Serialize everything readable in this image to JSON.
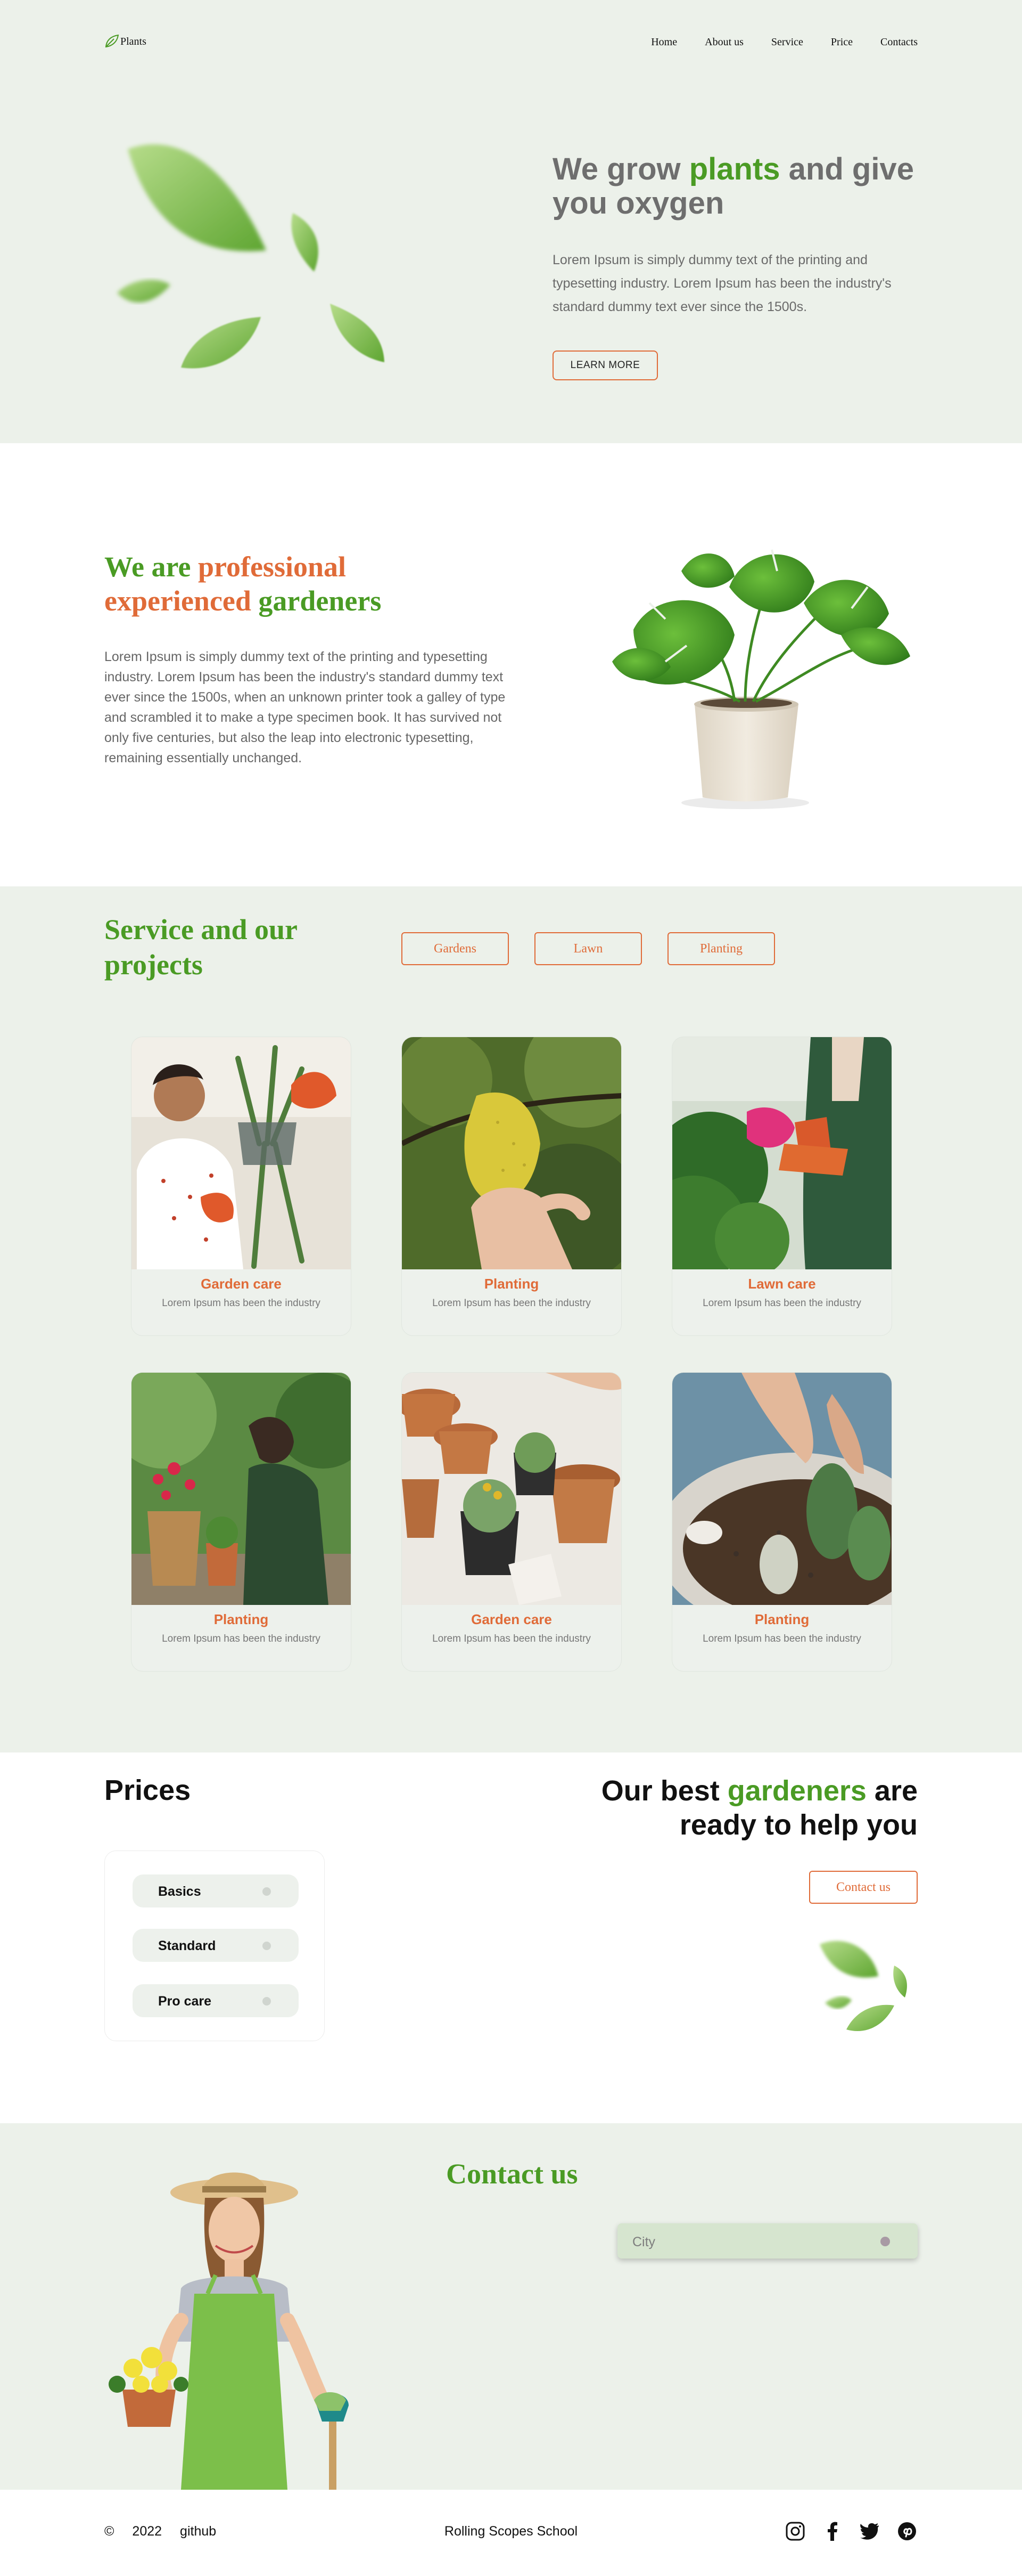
{
  "header": {
    "logo": "Plants",
    "nav": [
      "Home",
      "About us",
      "Service",
      "Price",
      "Contacts"
    ]
  },
  "hero": {
    "title_pre": "We grow ",
    "title_accent": "plants",
    "title_post": " and give you oxygen",
    "text": "Lorem Ipsum is simply dummy text of the printing and typesetting industry. Lorem Ipsum has been the industry's standard dummy text ever since the 1500s.",
    "button": "LEARN MORE"
  },
  "about": {
    "title_a": "We are ",
    "title_b": "professional experienced",
    "title_c": " gardeners",
    "text": "Lorem Ipsum is simply dummy text of the printing and typesetting industry. Lorem Ipsum has been the industry's standard dummy text ever since the 1500s, when an unknown printer took a galley of type and scrambled it to make a type specimen book. It has survived not only five centuries, but also the leap into electronic typesetting, remaining essentially unchanged."
  },
  "service": {
    "title": "Service and our projects",
    "filters": [
      "Gardens",
      "Lawn",
      "Planting"
    ],
    "cards": [
      {
        "title": "Garden care",
        "text": "Lorem Ipsum has been the industry"
      },
      {
        "title": "Planting",
        "text": "Lorem Ipsum has been the industry"
      },
      {
        "title": "Lawn care",
        "text": "Lorem Ipsum has been the industry"
      },
      {
        "title": "Planting",
        "text": "Lorem Ipsum has been the industry"
      },
      {
        "title": "Garden care",
        "text": "Lorem Ipsum has been the industry"
      },
      {
        "title": "Planting",
        "text": "Lorem Ipsum has been the industry"
      }
    ]
  },
  "prices": {
    "title": "Prices",
    "items": [
      "Basics",
      "Standard",
      "Pro care"
    ],
    "best_pre": "Our best ",
    "best_accent": "gardeners",
    "best_post": " are ready to help you",
    "button": "Contact us"
  },
  "contact": {
    "title": "Contact us",
    "city_placeholder": "City"
  },
  "footer": {
    "copyright": "©",
    "year": "2022",
    "github": "github",
    "school": "Rolling Scopes School",
    "socials": [
      "instagram-icon",
      "facebook-icon",
      "twitter-icon",
      "pinterest-icon"
    ]
  },
  "colors": {
    "accent_green": "#4a9b24",
    "accent_orange": "#e06b38",
    "section_bg": "#ecf1ea"
  }
}
